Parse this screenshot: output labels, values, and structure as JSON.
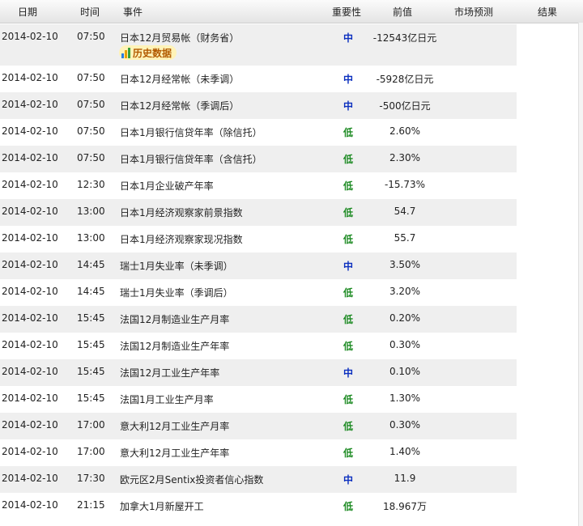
{
  "header": {
    "date": "日期",
    "time": "时间",
    "event": "事件",
    "importance": "重要性",
    "previous": "前值",
    "forecast": "市场预测",
    "result": "结果"
  },
  "history_label": "历史数据",
  "colors": {
    "importance_mid": "#0b2fbf",
    "importance_low": "#1c8a22",
    "row_shade": "#efefef"
  },
  "rows": [
    {
      "date": "2014-02-10",
      "time": "07:50",
      "event": "日本12月贸易帐（财务省）",
      "importance": "中",
      "previous": "-12543亿日元"
    },
    {
      "date": "2014-02-10",
      "time": "07:50",
      "event": "日本12月经常帐（未季调）",
      "importance": "中",
      "previous": "-5928亿日元"
    },
    {
      "date": "2014-02-10",
      "time": "07:50",
      "event": "日本12月经常帐（季调后）",
      "importance": "中",
      "previous": "-500亿日元"
    },
    {
      "date": "2014-02-10",
      "time": "07:50",
      "event": "日本1月银行信贷年率（除信托）",
      "importance": "低",
      "previous": "2.60%"
    },
    {
      "date": "2014-02-10",
      "time": "07:50",
      "event": "日本1月银行信贷年率（含信托）",
      "importance": "低",
      "previous": "2.30%"
    },
    {
      "date": "2014-02-10",
      "time": "12:30",
      "event": "日本1月企业破产年率",
      "importance": "低",
      "previous": "-15.73%"
    },
    {
      "date": "2014-02-10",
      "time": "13:00",
      "event": "日本1月经济观察家前景指数",
      "importance": "低",
      "previous": "54.7"
    },
    {
      "date": "2014-02-10",
      "time": "13:00",
      "event": "日本1月经济观察家现况指数",
      "importance": "低",
      "previous": "55.7"
    },
    {
      "date": "2014-02-10",
      "time": "14:45",
      "event": "瑞士1月失业率（未季调）",
      "importance": "中",
      "previous": "3.50%"
    },
    {
      "date": "2014-02-10",
      "time": "14:45",
      "event": "瑞士1月失业率（季调后）",
      "importance": "低",
      "previous": "3.20%"
    },
    {
      "date": "2014-02-10",
      "time": "15:45",
      "event": "法国12月制造业生产月率",
      "importance": "低",
      "previous": "0.20%"
    },
    {
      "date": "2014-02-10",
      "time": "15:45",
      "event": "法国12月制造业生产年率",
      "importance": "低",
      "previous": "0.30%"
    },
    {
      "date": "2014-02-10",
      "time": "15:45",
      "event": "法国12月工业生产年率",
      "importance": "中",
      "previous": "0.10%"
    },
    {
      "date": "2014-02-10",
      "time": "15:45",
      "event": "法国1月工业生产月率",
      "importance": "低",
      "previous": "1.30%"
    },
    {
      "date": "2014-02-10",
      "time": "17:00",
      "event": "意大利12月工业生产月率",
      "importance": "低",
      "previous": "0.30%"
    },
    {
      "date": "2014-02-10",
      "time": "17:00",
      "event": "意大利12月工业生产年率",
      "importance": "低",
      "previous": "1.40%"
    },
    {
      "date": "2014-02-10",
      "time": "17:30",
      "event": "欧元区2月Sentix投资者信心指数",
      "importance": "中",
      "previous": "11.9"
    },
    {
      "date": "2014-02-10",
      "time": "21:15",
      "event": "加拿大1月新屋开工",
      "importance": "低",
      "previous": "18.967万"
    }
  ]
}
